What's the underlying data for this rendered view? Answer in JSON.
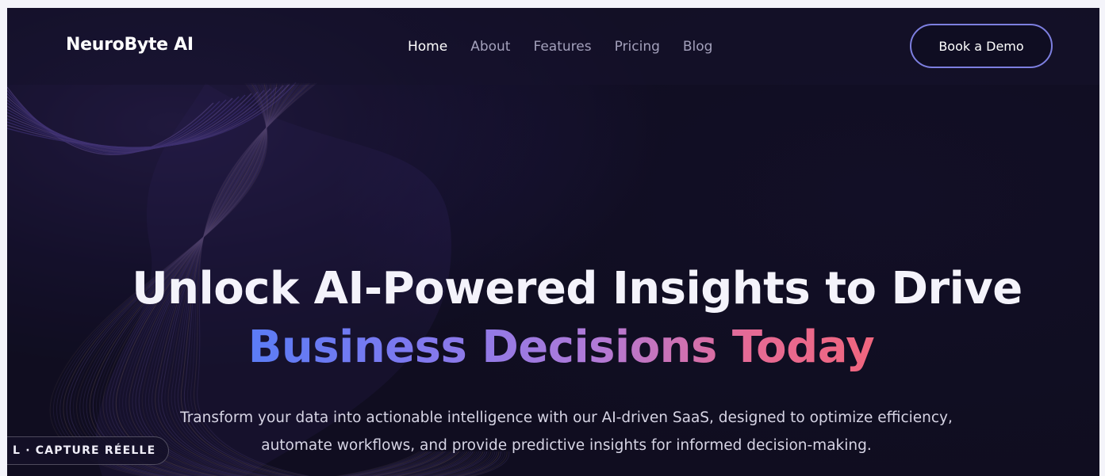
{
  "brand": {
    "name": "NeuroByte AI"
  },
  "nav": {
    "items": [
      {
        "label": "Home",
        "active": true
      },
      {
        "label": "About",
        "active": false
      },
      {
        "label": "Features",
        "active": false
      },
      {
        "label": "Pricing",
        "active": false
      },
      {
        "label": "Blog",
        "active": false
      }
    ],
    "cta_label": "Book a Demo"
  },
  "hero": {
    "title_line1": "Unlock AI-Powered Insights to Drive",
    "title_line2": "Business Decisions Today",
    "subtitle_line1": "Transform your data into actionable intelligence with our AI-driven SaaS, designed to optimize efficiency,",
    "subtitle_line2": "automate workflows, and provide predictive insights for informed decision-making."
  },
  "badge": {
    "text": "L · CAPTURE RÉELLE"
  },
  "colors": {
    "background": "#120f26",
    "accent_border": "#7d7fe0",
    "gradient_start": "#5b7cf5",
    "gradient_mid": "#b07ad8",
    "gradient_end": "#f0667e",
    "wave_lines": "#8a6df0"
  }
}
